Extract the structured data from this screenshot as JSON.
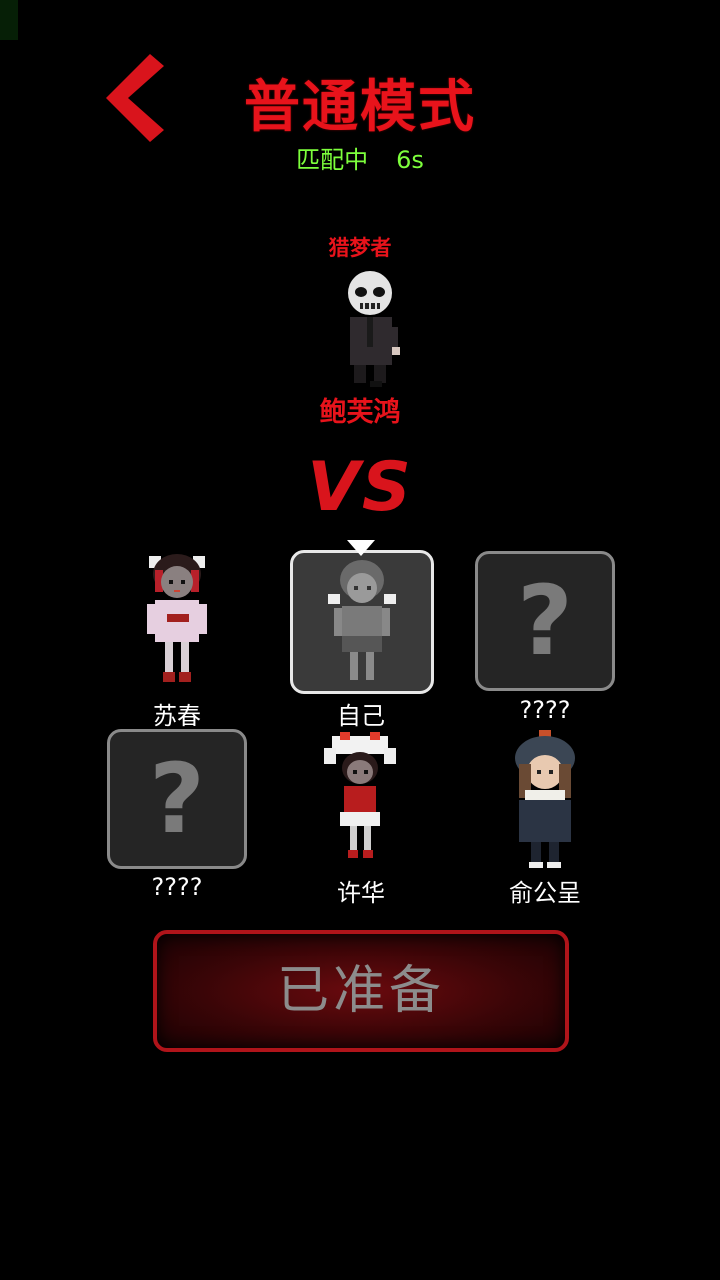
{
  "header": {
    "title": "普通模式",
    "match_status": "匹配中",
    "timer": "6s"
  },
  "hunter": {
    "role_title": "猎梦者",
    "name": "鲍芙鸿"
  },
  "vs_label": "VS",
  "players": [
    {
      "name": "苏春"
    },
    {
      "name": "自己"
    },
    {
      "name": "????"
    },
    {
      "name": "????"
    },
    {
      "name": "许华"
    },
    {
      "name": "俞公呈"
    }
  ],
  "ready_button": {
    "label": "已准备"
  },
  "colors": {
    "accent_red": "#e8131b",
    "match_green": "#7dff3c",
    "background": "#000000"
  },
  "icons": {
    "back": "chevron-left-icon",
    "unknown": "question-mark-icon"
  }
}
